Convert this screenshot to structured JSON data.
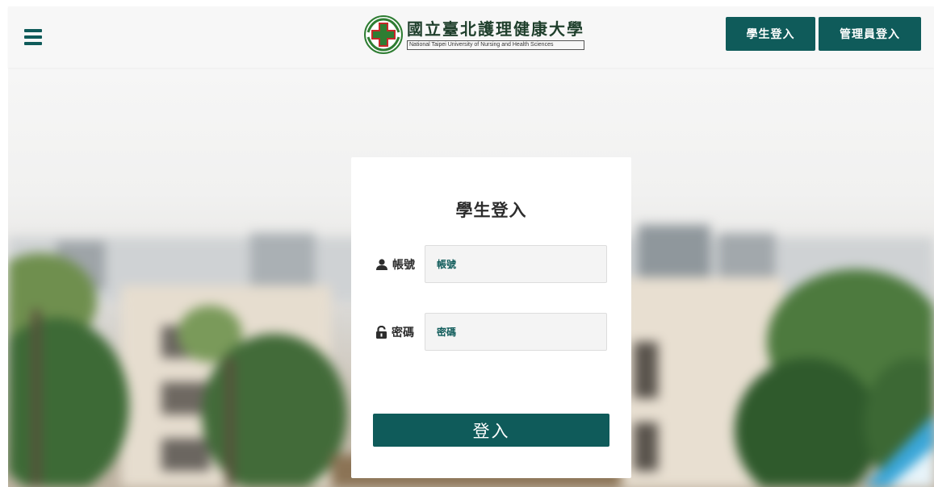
{
  "header": {
    "logo": {
      "name_cn": "國立臺北護理健康大學",
      "name_en": "National Taipei University of Nursing and Health Sciences"
    },
    "nav": {
      "student_login": "學生登入",
      "admin_login": "管理員登入"
    }
  },
  "login_card": {
    "title": "學生登入",
    "account": {
      "label": "帳號",
      "placeholder": "帳號",
      "value": ""
    },
    "password": {
      "label": "密碼",
      "placeholder": "密碼",
      "value": ""
    },
    "submit_label": "登入"
  },
  "icons": {
    "menu": "hamburger-menu-icon",
    "logo": "university-emblem-icon",
    "account": "user-icon",
    "password": "unlock-icon"
  },
  "colors": {
    "primary": "#0f5b5a",
    "header_bg": "#f7f7f7",
    "input_bg": "#f4f4f4",
    "text_dark": "#2d2d2d"
  }
}
